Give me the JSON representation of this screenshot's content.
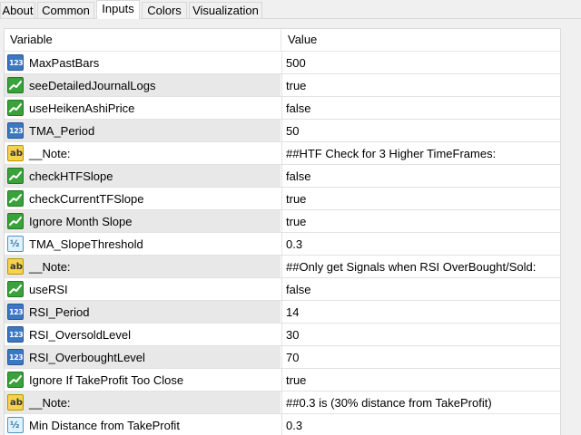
{
  "tabs": [
    {
      "label": "About"
    },
    {
      "label": "Common"
    },
    {
      "label": "Inputs"
    },
    {
      "label": "Colors"
    },
    {
      "label": "Visualization"
    }
  ],
  "active_tab": "Inputs",
  "table": {
    "headers": {
      "variable": "Variable",
      "value": "Value"
    },
    "rows": [
      {
        "icon": "int-icon",
        "name": "MaxPastBars",
        "value": "500"
      },
      {
        "icon": "bool-icon",
        "name": "seeDetailedJournalLogs",
        "value": "true"
      },
      {
        "icon": "bool-icon",
        "name": "useHeikenAshiPrice",
        "value": "false"
      },
      {
        "icon": "int-icon",
        "name": "TMA_Period",
        "value": "50"
      },
      {
        "icon": "string-icon",
        "name": "__Note:",
        "value": "##HTF Check for 3 Higher TimeFrames:"
      },
      {
        "icon": "bool-icon",
        "name": "checkHTFSlope",
        "value": "false"
      },
      {
        "icon": "bool-icon",
        "name": "checkCurrentTFSlope",
        "value": "true"
      },
      {
        "icon": "bool-icon",
        "name": "Ignore Month Slope",
        "value": "true"
      },
      {
        "icon": "double-icon",
        "name": "TMA_SlopeThreshold",
        "value": "0.3"
      },
      {
        "icon": "string-icon",
        "name": "__Note:",
        "value": "##Only get Signals when RSI OverBought/Sold:"
      },
      {
        "icon": "bool-icon",
        "name": "useRSI",
        "value": "false"
      },
      {
        "icon": "int-icon",
        "name": "RSI_Period",
        "value": "14"
      },
      {
        "icon": "int-icon",
        "name": "RSI_OversoldLevel",
        "value": "30"
      },
      {
        "icon": "int-icon",
        "name": "RSI_OverboughtLevel",
        "value": "70"
      },
      {
        "icon": "bool-icon",
        "name": "Ignore If TakeProfit Too Close",
        "value": "true"
      },
      {
        "icon": "string-icon",
        "name": "__Note:",
        "value": "##0.3 is (30% distance from TakeProfit)"
      },
      {
        "icon": "double-icon",
        "name": "Min Distance from TakeProfit",
        "value": "0.3"
      }
    ]
  },
  "icon_glyphs": {
    "int": "123",
    "string": "ab",
    "double": "½"
  }
}
